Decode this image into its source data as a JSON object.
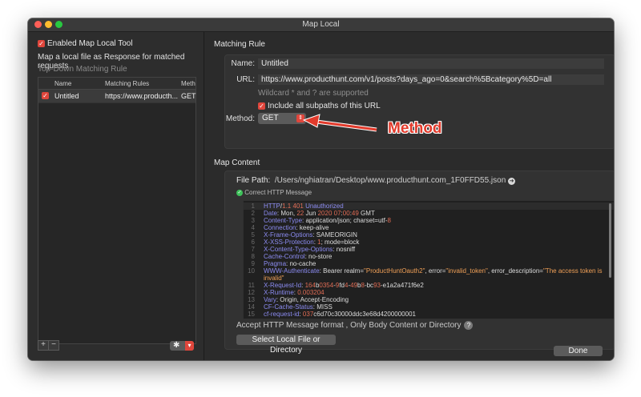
{
  "window": {
    "title": "Map Local"
  },
  "left": {
    "enable_label": "Enabled Map Local Tool",
    "description": "Map a local file as Response for matched requests",
    "section": "Top-Down Matching Rule",
    "columns": [
      "Name",
      "Matching Rules",
      "Meth"
    ],
    "rows": [
      {
        "name": "Untitled",
        "rule": "https://www.producth...",
        "method": "GET"
      }
    ],
    "add_icon": "+",
    "remove_icon": "−",
    "gear_icon": "gear-icon"
  },
  "matching": {
    "header": "Matching Rule",
    "name_label": "Name:",
    "name_value": "Untitled",
    "url_label": "URL:",
    "url_value": "https://www.producthunt.com/v1/posts?days_ago=0&search%5Bcategory%5D=all",
    "wildcard_hint": "Wildcard * and ? are supported",
    "subpaths_label": "Include all subpaths of this URL",
    "method_label": "Method:",
    "method_value": "GET"
  },
  "content": {
    "header": "Map Content",
    "file_path_label": "File Path:",
    "file_path_value": "/Users/nghiatran/Desktop/www.producthunt.com_1F0FFD55.json",
    "status": "Correct HTTP Message",
    "format_hint": "Accept HTTP Message format , Only Body Content or Directory",
    "select_button": "Select Local File or Directory"
  },
  "done_button": "Done",
  "annotation": "Method",
  "colors": {
    "accent": "#e0463c",
    "background": "#2b2b2b",
    "annotation": "#e23a2b"
  }
}
